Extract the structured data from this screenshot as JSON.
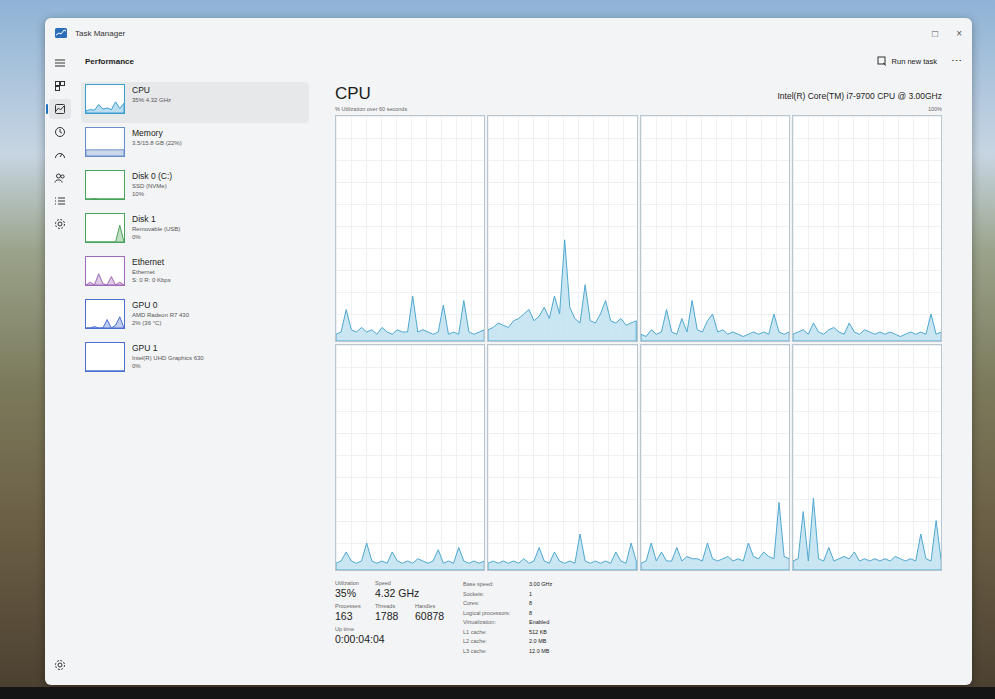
{
  "window": {
    "title": "Task Manager",
    "controls": [
      "□",
      "×"
    ]
  },
  "header": {
    "title": "Performance",
    "run_task": "Run new task",
    "more": "⋯"
  },
  "nav": [
    {
      "name": "menu",
      "selected": false
    },
    {
      "name": "processes",
      "selected": false
    },
    {
      "name": "performance",
      "selected": true
    },
    {
      "name": "app-history",
      "selected": false
    },
    {
      "name": "startup",
      "selected": false
    },
    {
      "name": "users",
      "selected": false
    },
    {
      "name": "details",
      "selected": false
    },
    {
      "name": "services",
      "selected": false
    }
  ],
  "sidebar": {
    "items": [
      {
        "title": "CPU",
        "lines": [
          "35% 4.32 GHz"
        ],
        "selected": true,
        "color": "#3a9fd0",
        "values": [
          8,
          12,
          10,
          30,
          14,
          18,
          12,
          40,
          16,
          35
        ]
      },
      {
        "title": "Memory",
        "lines": [
          "3.5/15.8 GB (22%)"
        ],
        "selected": false,
        "color": "#6a8fc8",
        "values": [
          22,
          22,
          22,
          22,
          22,
          22,
          22,
          22,
          22,
          22
        ]
      },
      {
        "title": "Disk 0 (C:)",
        "lines": [
          "SSD (NVMe)",
          "10%"
        ],
        "selected": false,
        "color": "#4aa35a",
        "values": [
          0,
          0,
          2,
          0,
          0,
          0,
          0,
          0,
          0,
          0
        ]
      },
      {
        "title": "Disk 1",
        "lines": [
          "Removable (USB)",
          "0%"
        ],
        "selected": false,
        "color": "#4aa35a",
        "values": [
          0,
          0,
          0,
          0,
          0,
          0,
          0,
          0,
          60,
          0
        ]
      },
      {
        "title": "Ethernet",
        "lines": [
          "Ethernet",
          "S: 0 R: 0 Kbps"
        ],
        "selected": false,
        "color": "#a06ab8",
        "values": [
          0,
          10,
          0,
          40,
          5,
          0,
          30,
          0,
          10,
          0
        ]
      },
      {
        "title": "GPU 0",
        "lines": [
          "AMD Radeon R7 430",
          "2% (36 °C)"
        ],
        "selected": false,
        "color": "#4a6fd0",
        "values": [
          0,
          0,
          5,
          0,
          0,
          30,
          0,
          10,
          40,
          0
        ]
      },
      {
        "title": "GPU 1",
        "lines": [
          "Intel(R) UHD Graphics 630",
          "0%"
        ],
        "selected": false,
        "color": "#4a6fd0",
        "values": [
          0,
          0,
          0,
          0,
          0,
          0,
          0,
          0,
          0,
          0
        ]
      }
    ]
  },
  "main": {
    "title": "CPU",
    "model": "Intel(R) Core(TM) i7-9700 CPU @ 3.00GHz",
    "axis_label": "% Utilization over 60 seconds",
    "axis_max": "100%",
    "cores": [
      {
        "values": [
          3,
          4,
          14,
          5,
          4,
          6,
          4,
          5,
          3,
          6,
          4,
          3,
          5,
          4,
          4,
          20,
          4,
          5,
          4,
          3,
          4,
          16,
          3,
          4,
          3,
          18,
          4,
          3,
          4,
          5
        ]
      },
      {
        "values": [
          5,
          6,
          8,
          7,
          6,
          9,
          10,
          12,
          14,
          9,
          11,
          15,
          10,
          20,
          12,
          45,
          15,
          10,
          8,
          25,
          9,
          8,
          12,
          18,
          9,
          8,
          10,
          7,
          8,
          9
        ]
      },
      {
        "values": [
          3,
          2,
          5,
          3,
          4,
          14,
          4,
          3,
          10,
          4,
          18,
          5,
          4,
          9,
          12,
          4,
          5,
          3,
          4,
          3,
          2,
          3,
          4,
          3,
          4,
          3,
          12,
          4,
          3,
          4
        ]
      },
      {
        "values": [
          3,
          4,
          5,
          3,
          8,
          4,
          3,
          5,
          6,
          4,
          3,
          8,
          4,
          3,
          5,
          4,
          3,
          4,
          3,
          4,
          3,
          2,
          3,
          4,
          3,
          4,
          3,
          12,
          3,
          4
        ]
      },
      {
        "values": [
          3,
          4,
          8,
          4,
          3,
          4,
          12,
          4,
          3,
          4,
          3,
          8,
          4,
          3,
          4,
          3,
          5,
          4,
          3,
          4,
          9,
          3,
          4,
          3,
          10,
          4,
          3,
          4,
          3,
          4
        ]
      },
      {
        "values": [
          3,
          4,
          3,
          4,
          3,
          4,
          3,
          5,
          3,
          4,
          10,
          4,
          3,
          8,
          4,
          3,
          4,
          3,
          16,
          4,
          3,
          4,
          3,
          4,
          3,
          8,
          4,
          3,
          12,
          4
        ]
      },
      {
        "values": [
          3,
          4,
          12,
          4,
          8,
          4,
          4,
          10,
          4,
          6,
          5,
          5,
          4,
          12,
          5,
          4,
          5,
          6,
          4,
          5,
          4,
          12,
          6,
          5,
          8,
          6,
          5,
          30,
          6,
          5
        ]
      },
      {
        "values": [
          4,
          5,
          26,
          4,
          32,
          5,
          4,
          10,
          4,
          5,
          6,
          5,
          8,
          4,
          5,
          4,
          5,
          4,
          5,
          4,
          6,
          5,
          4,
          5,
          4,
          16,
          5,
          4,
          22,
          4
        ]
      }
    ]
  },
  "stat_rows": [
    [
      {
        "label": "Utilization",
        "value": "35%"
      },
      {
        "label": "Speed",
        "value": "4.32 GHz"
      }
    ],
    [
      {
        "label": "Processes",
        "value": "163"
      },
      {
        "label": "Threads",
        "value": "1788"
      },
      {
        "label": "Handles",
        "value": "60878"
      }
    ],
    [
      {
        "label": "Up time",
        "value": "0:00:04:04"
      }
    ]
  ],
  "details": [
    {
      "label": "Base speed:",
      "value": "3.00 GHz"
    },
    {
      "label": "Sockets:",
      "value": "1"
    },
    {
      "label": "Cores:",
      "value": "8"
    },
    {
      "label": "Logical processors:",
      "value": "8"
    },
    {
      "label": "Virtualization:",
      "value": "Enabled"
    },
    {
      "label": "L1 cache:",
      "value": "512 KB"
    },
    {
      "label": "L2 cache:",
      "value": "2.0 MB"
    },
    {
      "label": "L3 cache:",
      "value": "12.0 MB"
    }
  ]
}
